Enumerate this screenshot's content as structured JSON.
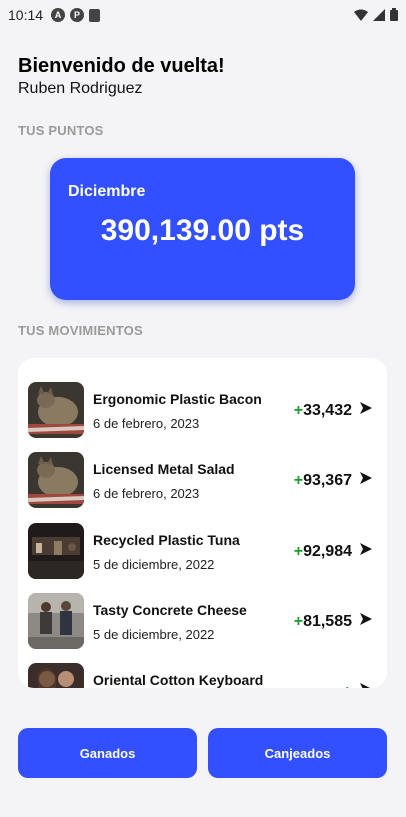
{
  "status_bar": {
    "time": "10:14",
    "left_icons": [
      "a-icon",
      "p-icon",
      "sim-card-icon"
    ],
    "right_icons": [
      "wifi-icon",
      "signal-icon",
      "battery-icon"
    ]
  },
  "header": {
    "welcome": "Bienvenido de vuelta!",
    "user_name": "Ruben Rodriguez"
  },
  "points": {
    "section_label": "TUS PUNTOS",
    "month": "Diciembre",
    "value": "390,139.00 pts"
  },
  "movements": {
    "section_label": "TUS MOVIMIENTOS",
    "items": [
      {
        "title": "Ergonomic Plastic Bacon",
        "date": "6 de febrero, 2023",
        "sign": "+",
        "amount": "33,432",
        "image": "cat-photo"
      },
      {
        "title": "Licensed Metal Salad",
        "date": "6 de febrero, 2023",
        "sign": "+",
        "amount": "93,367",
        "image": "cat-photo"
      },
      {
        "title": "Recycled Plastic Tuna",
        "date": "5 de diciembre, 2022",
        "sign": "+",
        "amount": "92,984",
        "image": "dark-room-photo"
      },
      {
        "title": "Tasty Concrete Cheese",
        "date": "5 de diciembre, 2022",
        "sign": "+",
        "amount": "81,585",
        "image": "people-street-photo"
      },
      {
        "title": "Oriental Cotton Keyboard",
        "date": "",
        "sign": "+",
        "amount": "",
        "image": "people-photo"
      }
    ]
  },
  "buttons": {
    "earned": "Ganados",
    "redeemed": "Canjeados"
  },
  "colors": {
    "accent": "#3250ff",
    "positive": "#1a9e2c",
    "background": "#f4f4f6"
  }
}
